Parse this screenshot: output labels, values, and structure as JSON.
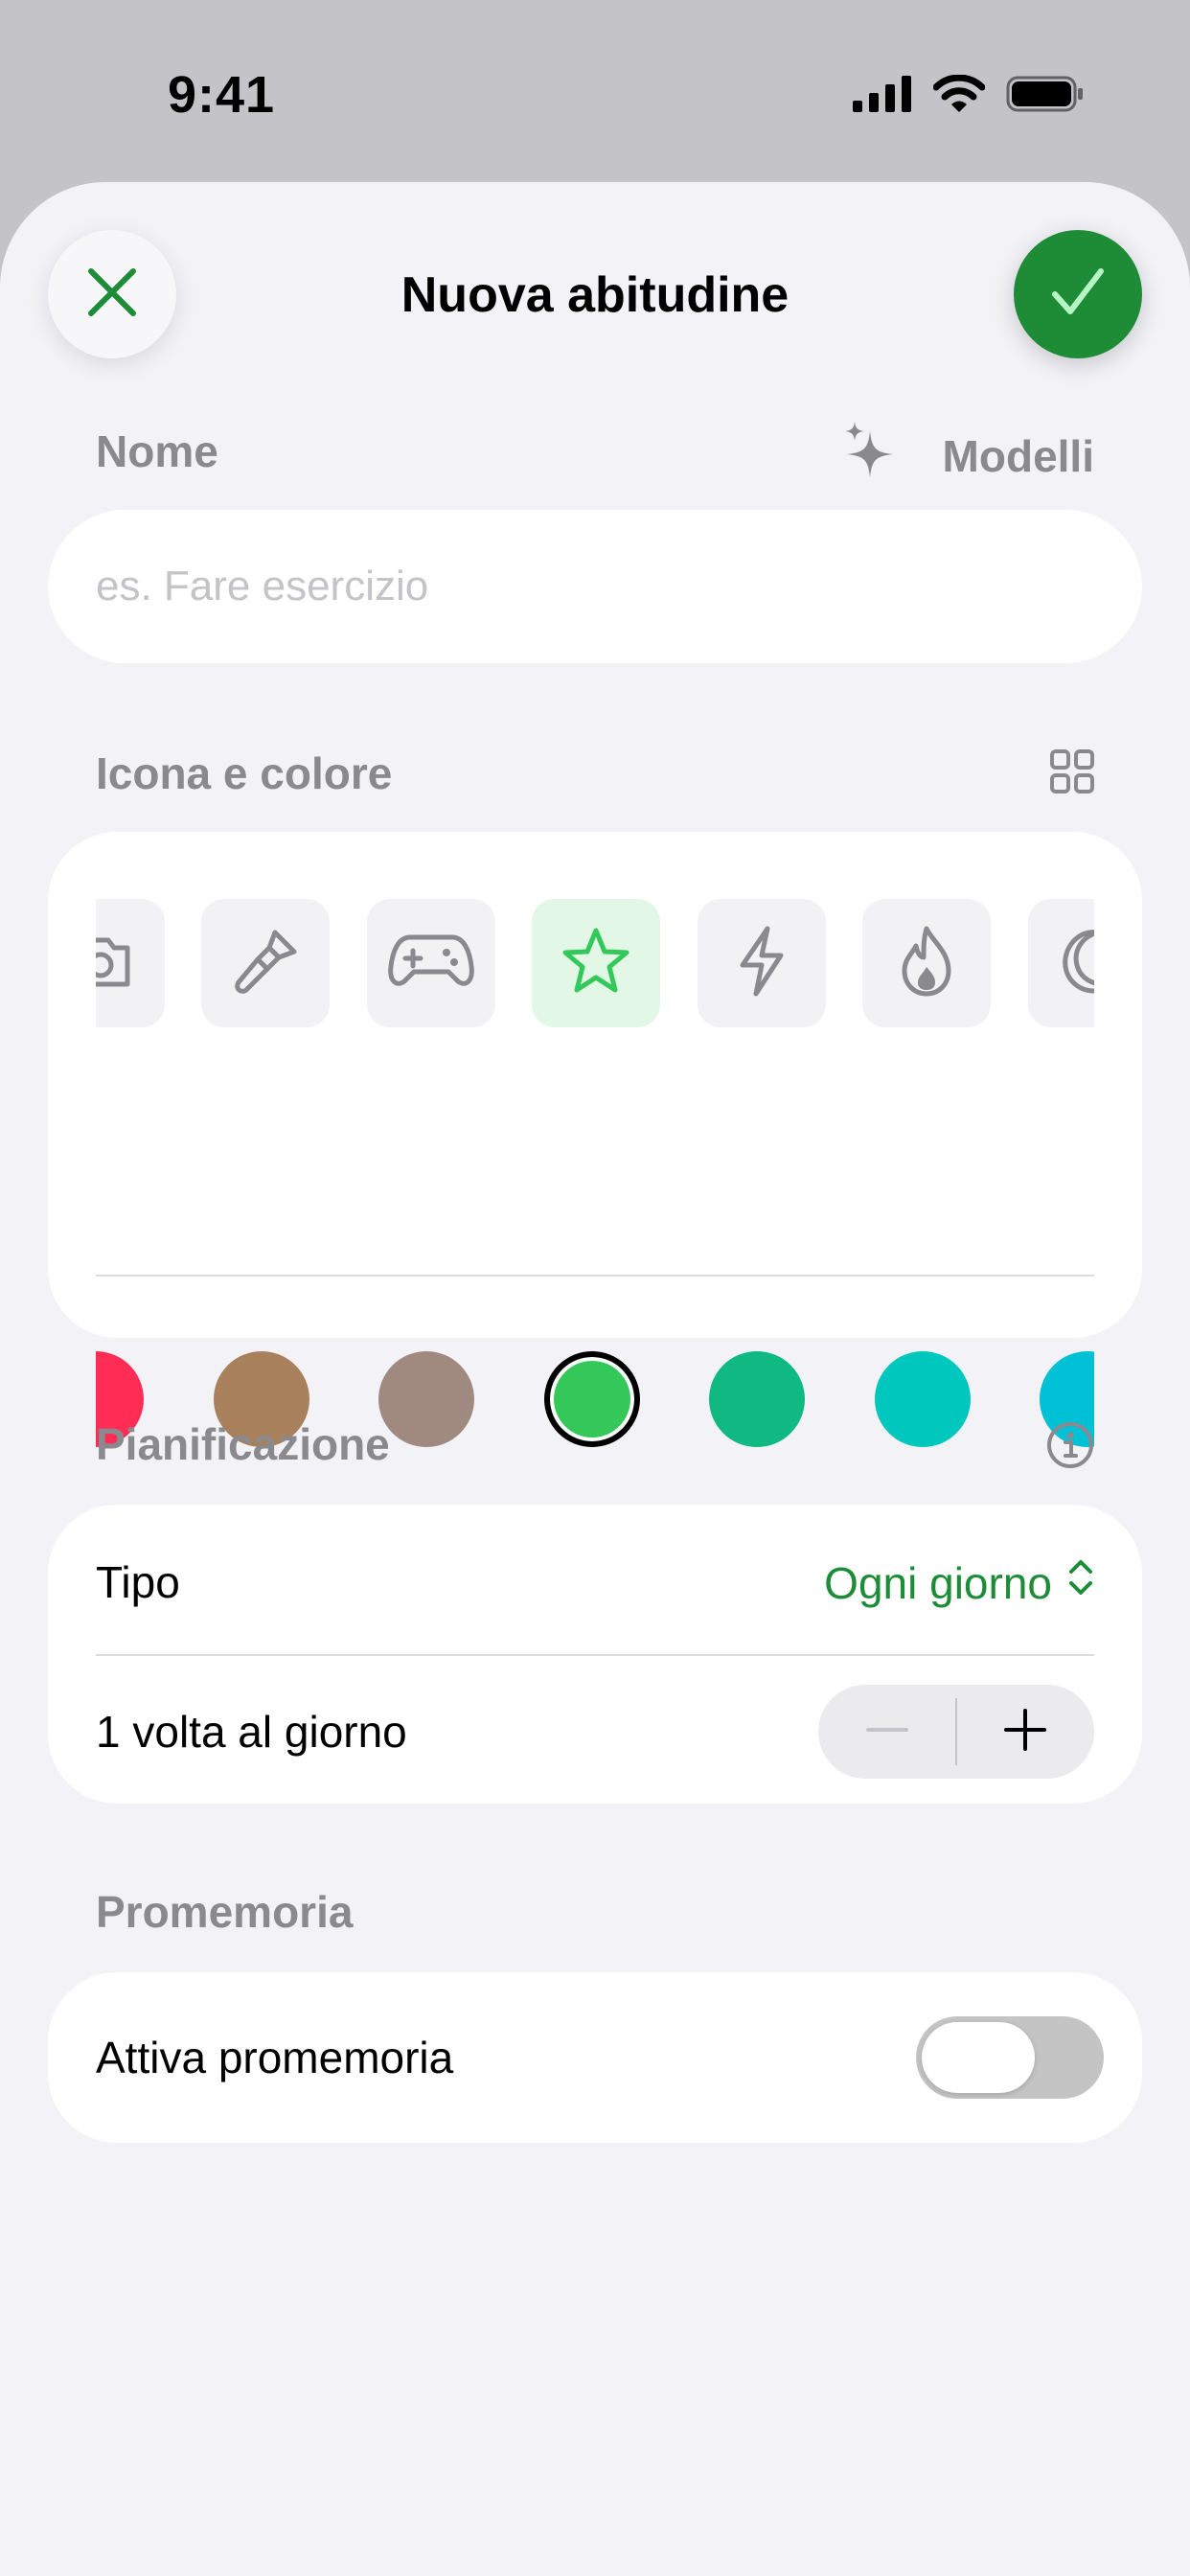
{
  "status_bar": {
    "time": "9:41",
    "icons": [
      "cellular-signal-icon",
      "wifi-icon",
      "battery-icon"
    ]
  },
  "sheet": {
    "title": "Nuova abitudine",
    "close_icon": "close-icon",
    "confirm_icon": "checkmark-icon"
  },
  "name_section": {
    "label": "Nome",
    "templates_label": "Modelli",
    "templates_icon": "sparkles-icon",
    "input_value": "",
    "input_placeholder": "es. Fare esercizio"
  },
  "icon_color_section": {
    "label": "Icona e colore",
    "grid_icon": "grid-icon",
    "icons": [
      {
        "name": "camera-icon",
        "selected": false
      },
      {
        "name": "paintbrush-icon",
        "selected": false
      },
      {
        "name": "gamecontroller-icon",
        "selected": false
      },
      {
        "name": "star-icon",
        "selected": true
      },
      {
        "name": "bolt-icon",
        "selected": false
      },
      {
        "name": "flame-icon",
        "selected": false
      },
      {
        "name": "moon-icon",
        "selected": false
      }
    ],
    "colors": [
      {
        "hex": "#ff2d55",
        "selected": false
      },
      {
        "hex": "#a8805c",
        "selected": false
      },
      {
        "hex": "#a08a80",
        "selected": false
      },
      {
        "hex": "#34c759",
        "selected": true
      },
      {
        "hex": "#10b981",
        "selected": false
      },
      {
        "hex": "#00c7be",
        "selected": false
      },
      {
        "hex": "#00c0d6",
        "selected": false
      }
    ]
  },
  "schedule_section": {
    "label": "Pianificazione",
    "info_icon": "info-icon",
    "type_label": "Tipo",
    "type_value": "Ogni giorno",
    "frequency_label": "1 volta al giorno"
  },
  "reminder_section": {
    "label": "Promemoria",
    "toggle_label": "Attiva promemoria",
    "toggle_on": false
  },
  "colors": {
    "accent": "#1e8c37",
    "background": "#f2f2f7",
    "selected_icon_tint": "#34c759"
  }
}
